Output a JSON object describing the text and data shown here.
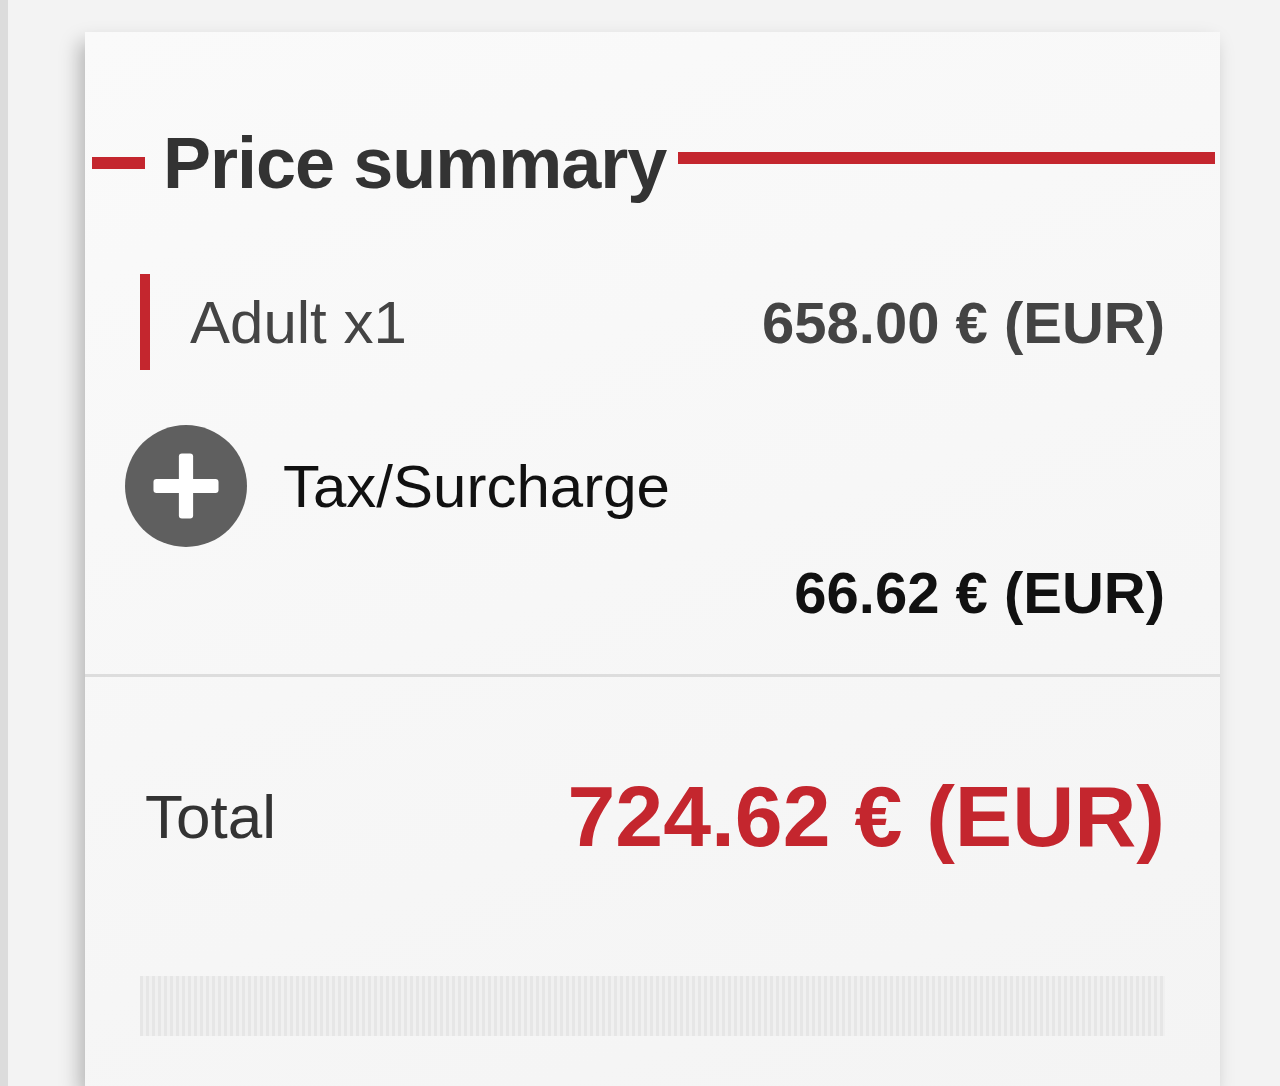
{
  "title": "Price summary",
  "lines": [
    {
      "kind": "passenger",
      "label": "Adult x1",
      "amount": "658.00 € (EUR)"
    },
    {
      "kind": "expandable",
      "label": "Tax/Surcharge",
      "amount": "66.62 € (EUR)",
      "expanded": false
    }
  ],
  "total": {
    "label": "Total",
    "amount": "724.62 € (EUR)"
  }
}
